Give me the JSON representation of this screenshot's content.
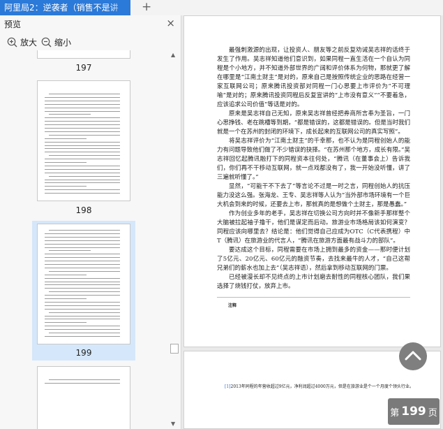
{
  "tab": {
    "title": "阿里局2：逆袭者（销售不是讲"
  },
  "sidebar": {
    "title": "预览",
    "zoom_in_label": "放大",
    "zoom_out_label": "缩小",
    "pages": [
      "197",
      "198",
      "199"
    ],
    "selected_page": "199"
  },
  "document": {
    "paragraphs": [
      "最强刺激源的出现，让投资人、朋友等之前反复劝诫吴志祥的话终于发生了作用。吴志祥知道他们意识到，如果同程一直生活在一个自认为同程是个小地方，并不知道外部世界的广阔和评价体系为何物，那就更了解在哪里是“江南土财主”是对的，原来自己是按照传统企业的思路在经营一家互联网公司；原来腾讯投资部对同程一门心思要上市评价为“不可理喻”是对的；原来腾讯投资同程后反复宣讲的“上市没有意义”“不要着急，应该追求公司价值”等话是对的。",
      "原来是吴志祥自己无知，原来吴志祥曾经把券商所言奉为圣旨，一门心思挣钱、老在跳槽等到期，“都是错误的，这都是错误的。但是当时我们就是一个在苏州的封闭的环境下，成长起来的互联网公司的真实写照”。",
      "将吴志祥评价为“江南土财主”的千幸那，也不认为是同程创始人的能力有问题导致他们做了不少错误的抉择。“在苏州那个地方，成长有限。”吴志祥回忆起腾讯融打下的同程资本往何处，“腾讯（在董事会上）告诉我们，你们再不干移动互联网，就一点戏都没有了，我一开始没听懂，讲了三遍就听懂了。”",
      "显然，“可能干不下去了”等言论不过是一时之言，同程创始人的抗压能力没这么强。张海龙、王专、吴志祥等人认为“当外部市场环境有一个巨大机会到来的时候，还要去上市，那就真的是想做个土财主，那是愚蠢。”",
      "作为创业多年的老手，吴志祥在切换公司方向时并不像新手那样整个大脑被拉起袖子撸干，他们是谋定而后动。旅游业市场格局该如何演变？同程应该向哪里去？结论是：他们觉得自己应成为OTC（C代表携程）中T（腾讯）在旅游业的代言人，“腾讯在旅游方面最有战斗力的部队”。",
      "要达成这个目标，同程需要在市场上拥到最多的资金——那时便计划了5亿元、20亿元、60亿元的融资节奏，去找来最牛的人才，“自己这帮兄弟们的薪水也加上去”（吴志祥语），然后拿到移动互联网的门票。",
      "已经被漫长却不见终点的上市计划磨去耐性的同程核心团队，我们果选择了烧钱打仗，放弃上市。"
    ],
    "note_label": "注释",
    "footnote_marker": "[1]",
    "footnote_text": "2013年同程的年营收超过9亿元，净利润超过4000万元，但是在旅游业是个一个月度个领头行业。",
    "page_indicator_prefix": "第",
    "page_indicator_number": "199",
    "page_indicator_suffix": "页"
  },
  "icons": {
    "zoom_in": "zoom-in-icon",
    "zoom_out": "zoom-out-icon",
    "close": "close-icon",
    "scroll_top": "chevron-up-icon",
    "new_tab": "plus-icon"
  },
  "colors": {
    "tab_active": "#2b79d8",
    "thumb_selected": "#d5e7fa",
    "badge": "#7a7a7a"
  }
}
